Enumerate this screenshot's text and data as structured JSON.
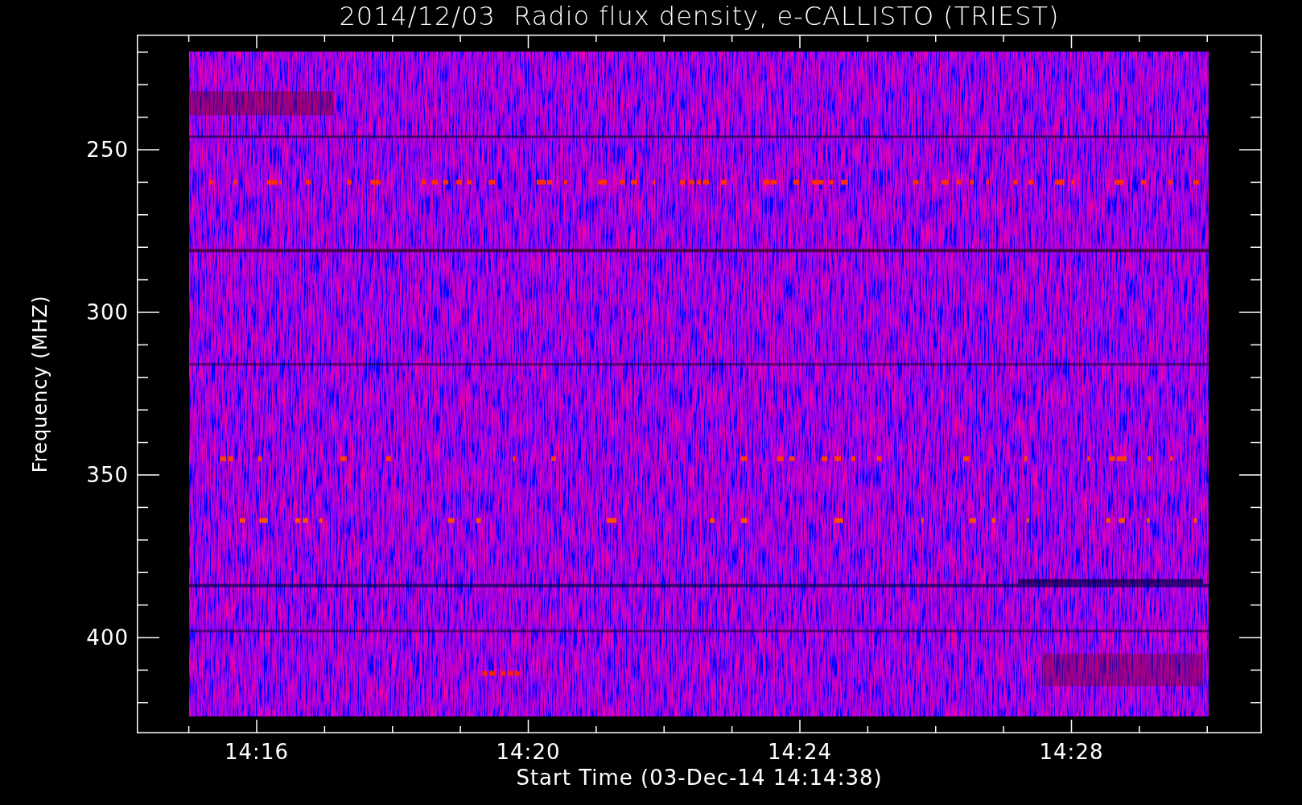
{
  "title": "2014/12/03  Radio flux density, e-CALLISTO (TRIEST)",
  "y_axis": {
    "label": "Frequency (MHZ)",
    "ticks": [
      "250",
      "300",
      "350",
      "400"
    ]
  },
  "x_axis": {
    "label": "Start Time (03-Dec-14 14:14:38)",
    "ticks": [
      "14:16",
      "14:20",
      "14:24",
      "14:28"
    ]
  }
}
